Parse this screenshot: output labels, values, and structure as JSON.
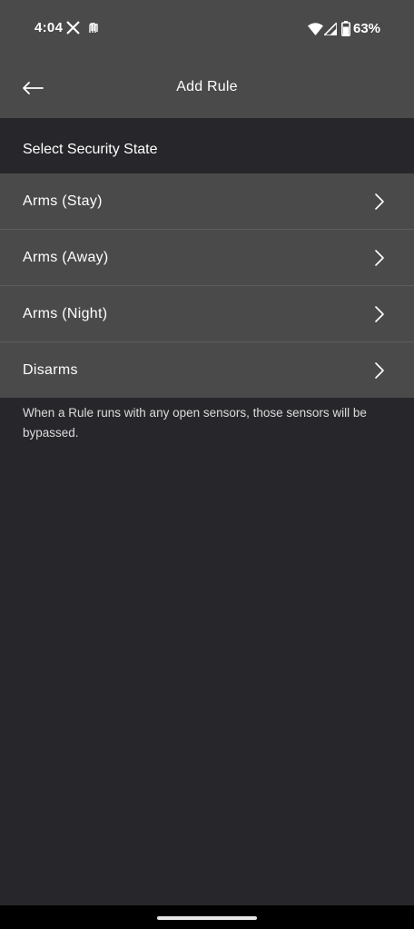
{
  "status_bar": {
    "time": "4:04",
    "battery": "63%",
    "icons": [
      "x-icon",
      "notification-icon",
      "wifi-icon",
      "signal-icon",
      "battery-icon"
    ]
  },
  "app_bar": {
    "back_icon": "back-arrow-icon",
    "title": "Add Rule"
  },
  "section": {
    "header": "Select Security State"
  },
  "states": [
    {
      "label": "Arms (Stay)",
      "icon": "chevron-right-icon"
    },
    {
      "label": "Arms (Away)",
      "icon": "chevron-right-icon"
    },
    {
      "label": "Arms (Night)",
      "icon": "chevron-right-icon"
    },
    {
      "label": "Disarms",
      "icon": "chevron-right-icon"
    }
  ],
  "footnote": "When a Rule runs with any open sensors, those sensors will be bypassed.",
  "colors": {
    "background": "#27272b",
    "app_bar": "#4a4a4a",
    "row": "#4a4a4a",
    "divider": "#5c5c5c"
  }
}
